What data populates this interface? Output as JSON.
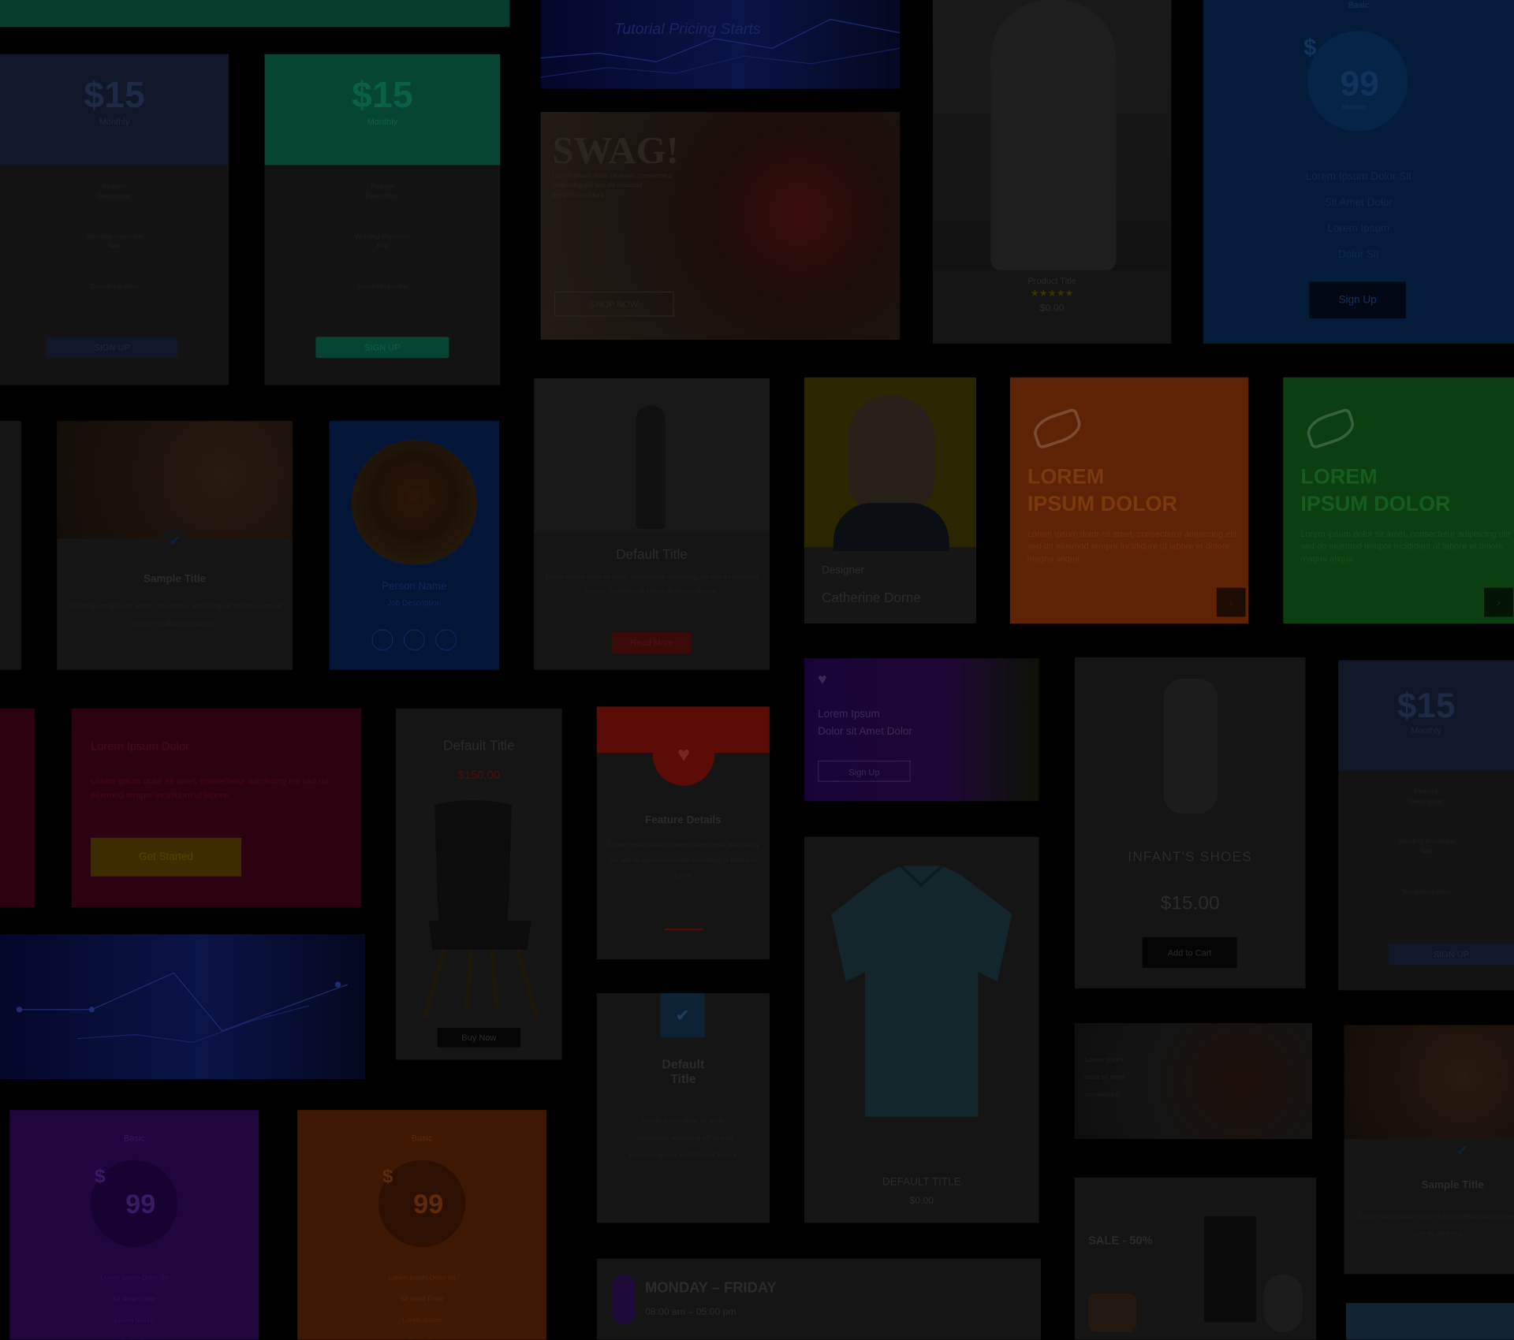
{
  "colors": {
    "background": "#000000",
    "navy": "#0f1728",
    "green": "#064434",
    "orange": "#5e2305",
    "leaf_green": "#0b3f12",
    "maroon": "#2c0210",
    "purple": "#21053f",
    "red": "#5b0c07",
    "blue_dark": "#041b3a",
    "teal_top": "#063b2e"
  },
  "pricing_small": [
    {
      "price": "$15",
      "period": "Monthly",
      "f1": "Feature",
      "f2": "Description",
      "f3": "Wording Important",
      "f4": "Text",
      "f5": "Something extra",
      "cta": "SIGN UP"
    },
    {
      "price": "$15",
      "period": "Monthly",
      "f1": "Feature",
      "f2": "Description",
      "f3": "Wording Important",
      "f4": "Text",
      "f5": "Something extra",
      "cta": "SIGN UP"
    },
    {
      "price": "$15",
      "period": "Monthly",
      "f1": "Feature",
      "f2": "Description",
      "f3": "Wording Important",
      "f4": "Text",
      "f5": "Something extra",
      "cta": "SIGN UP"
    }
  ],
  "banner_night": {
    "text": "Tutorial Pricing Starts"
  },
  "swag": {
    "title": "SWAG!",
    "body1": "Lorem ipsum dolor sit amet, consectetur",
    "body2": "adipiscing elit sed do eiusmod",
    "body3": "tempor incididunt",
    "cta": "SHOP NOW"
  },
  "product_woman": {
    "name": "Product Title",
    "stars": "★★★★★",
    "price": "$0.00"
  },
  "pricing_circle_blue": {
    "tier": "Basic",
    "currency": "$",
    "amount": "99",
    "period": "Monthly",
    "items": [
      "Lorem Ipsum Dolor Sit",
      "Sit Amet Dolor",
      "Lorem Ipsum",
      "Dolor Sit"
    ],
    "cta": "Sign Up"
  },
  "food_card": {
    "title": "Sample Title",
    "body": "Lorem ipsum dolor sit amet, consectetur adipiscing elit sed do eiusmod tempor incididunt ut labore."
  },
  "team_blue": {
    "name": "Person Name",
    "role": "Job Description"
  },
  "product_figure": {
    "title": "Default Title",
    "body": "Lorem ipsum dolor sit amet, consectetur adipiscing elit sed do eiusmod tempor incididunt ut labore et dolore magna.",
    "cta": "Read More"
  },
  "testimonial": {
    "label": "Designer",
    "name": "Catherine Dorne"
  },
  "cta_orange": {
    "title1": "LOREM",
    "title2": "IPSUM DOLOR",
    "body": "Lorem ipsum dolor sit amet, consectetur adipiscing elit sed do eiusmod tempor incididunt ut labore et dolore magna aliqua."
  },
  "cta_green": {
    "title1": "LOREM",
    "title2": "IPSUM DOLOR",
    "body": "Lorem ipsum dolor sit amet, consectetur adipiscing elit sed do eiusmod tempor incididunt ut labore et dolore magna aliqua."
  },
  "purple_banner": {
    "line1": "Lorem Ipsum",
    "line2": "Dolor sit Amet Dolor",
    "cta": "Sign Up"
  },
  "shoes_product": {
    "title": "INFANT'S SHOES",
    "price": "$15.00",
    "cta": "Add to Cart"
  },
  "maroon_cta": {
    "title": "Lorem Ipsum Dolor",
    "body": "Lorem ipsum dolor sit amet, consectetur adipiscing elit sed do eiusmod tempor incididunt ut labore.",
    "cta": "Get Started"
  },
  "chair": {
    "title": "Default Title",
    "price": "$150.00",
    "cta": "Buy Now"
  },
  "feature_red": {
    "title": "Feature Details",
    "body": "Lorem ipsum dolor sit amet consectetur adipiscing elit sed do eiusmod tempor incididunt ut labore et dolore."
  },
  "default_product": {
    "title": "DEFAULT TITLE",
    "price": "$0.00"
  },
  "plain_card": {
    "title1": "Default",
    "title2": "Title",
    "body": "Lorem ipsum dolor sit amet consectetur adipiscing elit sed do eiusmod tempor incididunt ut labore"
  },
  "opening_hours": {
    "days": "MONDAY – FRIDAY",
    "hours": "08:00 am – 05:00 pm"
  },
  "pricing_circle_purple": {
    "tier": "Basic",
    "currency": "$",
    "amount": "99",
    "items": [
      "Lorem Ipsum Dolor Sit",
      "Sit Amet Dolor",
      "Lorem Ipsum",
      "Dolor Sit"
    ]
  },
  "pricing_circle_orange": {
    "tier": "Basic",
    "currency": "$",
    "amount": "99",
    "items": [
      "Lorem Ipsum Dolor Sit",
      "Sit Amet Dolor",
      "Lorem Ipsum",
      "Dolor Sit"
    ]
  },
  "bike_banner": {
    "line1": "Lorem ipsum",
    "line2": "dolor sit amet",
    "line3": "consectetur"
  },
  "furniture_banner": {
    "label": "SALE - 50%"
  },
  "food_card2": {
    "title": "Sample Title",
    "body": "Lorem ipsum dolor sit amet consectetur adipiscing elit sed do eiusmod."
  }
}
